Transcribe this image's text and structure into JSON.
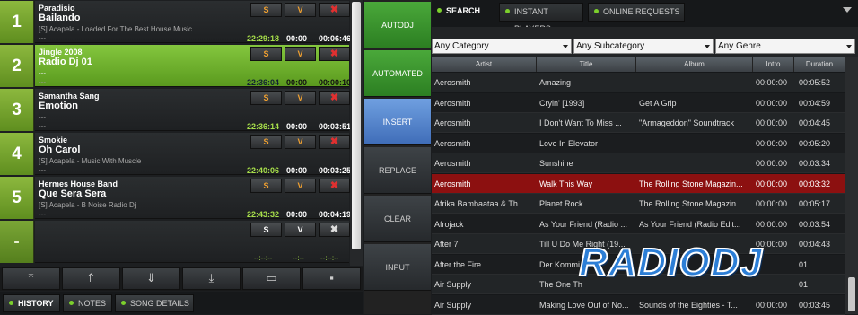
{
  "playlist": [
    {
      "num": "1",
      "artist": "Paradisio",
      "title": "Bailando",
      "info": "[S] Acapela - Loaded For The Best House Music",
      "dash": "---",
      "start": "22:29:18",
      "intro": "00:00",
      "duration": "00:06:46",
      "active": false
    },
    {
      "num": "2",
      "artist": "Jingle 2008",
      "title": "Radio Dj 01",
      "info": "---",
      "dash": "---",
      "start": "22:36:04",
      "intro": "00:00",
      "duration": "00:00:10",
      "active": true
    },
    {
      "num": "3",
      "artist": "Samantha Sang",
      "title": "Emotion",
      "info": "---",
      "dash": "---",
      "start": "22:36:14",
      "intro": "00:00",
      "duration": "00:03:51",
      "active": false
    },
    {
      "num": "4",
      "artist": "Smokie",
      "title": "Oh Carol",
      "info": "[S] Acapela - Music With Muscle",
      "dash": "---",
      "start": "22:40:06",
      "intro": "00:00",
      "duration": "00:03:25",
      "active": false
    },
    {
      "num": "5",
      "artist": "Hermes House Band",
      "title": "Que Sera Sera",
      "info": "[S] Acapela - B Noise Radio Dj",
      "dash": "---",
      "start": "22:43:32",
      "intro": "00:00",
      "duration": "00:04:19",
      "active": false
    }
  ],
  "empty_slot": {
    "num": "-",
    "t1": "--:--:--",
    "t2": "--:--",
    "t3": "--:--:--"
  },
  "item_buttons": {
    "s": "S",
    "v": "V",
    "x": "✖"
  },
  "playlist_nav": [
    "⤒",
    "⇑",
    "⇓",
    "⤓",
    "▭",
    "▪"
  ],
  "bottom_tabs": [
    {
      "label": "HISTORY",
      "active": true
    },
    {
      "label": "NOTES",
      "active": false
    },
    {
      "label": "SONG DETAILS",
      "active": false
    }
  ],
  "modes": [
    {
      "label": "AUTODJ",
      "state": "on"
    },
    {
      "label": "AUTOMATED",
      "state": "on"
    },
    {
      "label": "INSERT",
      "state": "sel"
    },
    {
      "label": "REPLACE",
      "state": "off"
    },
    {
      "label": "CLEAR",
      "state": "off"
    },
    {
      "label": "INPUT",
      "state": "off"
    }
  ],
  "right_tabs": [
    {
      "label": "SEARCH",
      "active": true
    },
    {
      "label": "INSTANT PLAYERS",
      "active": false
    },
    {
      "label": "ONLINE REQUESTS",
      "active": false
    }
  ],
  "filters": {
    "category": "Any Category",
    "subcategory": "Any Subcategory",
    "genre": "Any Genre"
  },
  "columns": [
    "Artist",
    "Title",
    "Album",
    "Intro",
    "Duration"
  ],
  "tracks": [
    {
      "artist": "Aerosmith",
      "title": "Amazing",
      "album": "",
      "intro": "00:00:00",
      "duration": "00:05:52",
      "selected": false
    },
    {
      "artist": "Aerosmith",
      "title": "Cryin' [1993]",
      "album": "Get A Grip",
      "intro": "00:00:00",
      "duration": "00:04:59",
      "selected": false
    },
    {
      "artist": "Aerosmith",
      "title": "I Don't Want To Miss ...",
      "album": "\"Armageddon\" Soundtrack",
      "intro": "00:00:00",
      "duration": "00:04:45",
      "selected": false
    },
    {
      "artist": "Aerosmith",
      "title": "Love In Elevator",
      "album": "",
      "intro": "00:00:00",
      "duration": "00:05:20",
      "selected": false
    },
    {
      "artist": "Aerosmith",
      "title": "Sunshine",
      "album": "",
      "intro": "00:00:00",
      "duration": "00:03:34",
      "selected": false
    },
    {
      "artist": "Aerosmith",
      "title": "Walk This Way",
      "album": "The Rolling Stone Magazin...",
      "intro": "00:00:00",
      "duration": "00:03:32",
      "selected": true
    },
    {
      "artist": "Afrika Bambaataa & Th...",
      "title": "Planet Rock",
      "album": "The Rolling Stone Magazin...",
      "intro": "00:00:00",
      "duration": "00:05:17",
      "selected": false
    },
    {
      "artist": "Afrojack",
      "title": "As Your Friend (Radio ...",
      "album": "As Your Friend (Radio Edit...",
      "intro": "00:00:00",
      "duration": "00:03:54",
      "selected": false
    },
    {
      "artist": "After 7",
      "title": "Till U Do Me Right (19...",
      "album": "",
      "intro": "00:00:00",
      "duration": "00:04:43",
      "selected": false
    },
    {
      "artist": "After the Fire",
      "title": "Der Kommi",
      "album": "",
      "intro": "",
      "duration": "01",
      "selected": false
    },
    {
      "artist": "Air Supply",
      "title": "The One Th",
      "album": "",
      "intro": "",
      "duration": "01",
      "selected": false
    },
    {
      "artist": "Air Supply",
      "title": "Making Love Out of No...",
      "album": "Sounds of the Eighties - T...",
      "intro": "00:00:00",
      "duration": "00:03:45",
      "selected": false
    }
  ],
  "logo": "RADIODJ",
  "colors": {
    "accent_green": "#6fb62c",
    "selected_row": "#8c1010",
    "insert_blue": "#4f7fc8"
  }
}
